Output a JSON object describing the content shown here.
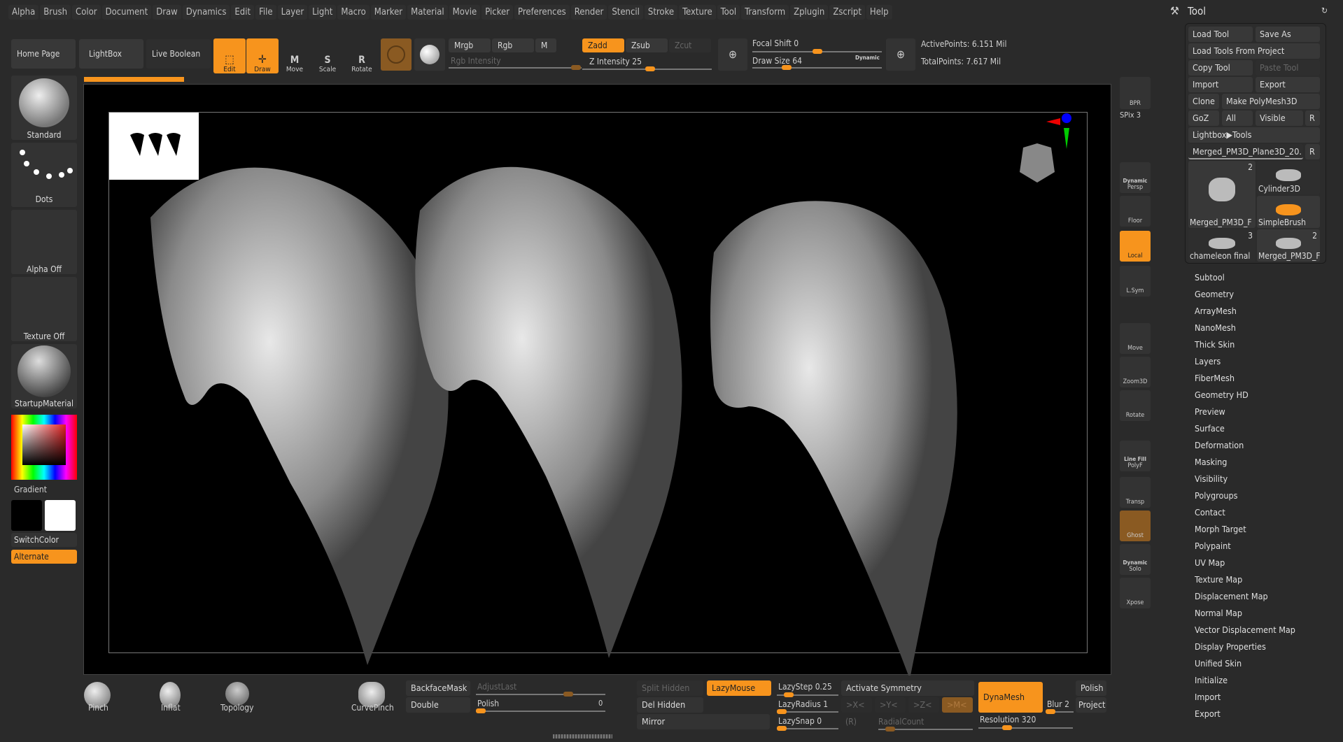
{
  "menu": [
    "Alpha",
    "Brush",
    "Color",
    "Document",
    "Draw",
    "Dynamics",
    "Edit",
    "File",
    "Layer",
    "Light",
    "Macro",
    "Marker",
    "Material",
    "Movie",
    "Picker",
    "Preferences",
    "Render",
    "Stencil",
    "Stroke",
    "Texture",
    "Tool",
    "Transform",
    "Zplugin",
    "Zscript",
    "Help"
  ],
  "toolbar": {
    "home": "Home Page",
    "lightbox": "LightBox",
    "live_boolean": "Live Boolean",
    "edit": "Edit",
    "draw": "Draw",
    "move": "Move",
    "scale": "Scale",
    "rotate": "Rotate",
    "mrgb": "Mrgb",
    "rgb": "Rgb",
    "m": "M",
    "rgb_intensity": "Rgb Intensity",
    "zadd": "Zadd",
    "zsub": "Zsub",
    "zcut": "Zcut",
    "z_intensity": "Z Intensity 25",
    "z_intensity_value": 25,
    "focal_shift": "Focal Shift 0",
    "draw_size": "Draw Size 64",
    "dynamic": "Dynamic",
    "active_points": "ActivePoints: 6.151 Mil",
    "total_points": "TotalPoints: 7.617 Mil"
  },
  "left": {
    "brush": "Standard",
    "stroke": "Dots",
    "alpha": "Alpha Off",
    "texture": "Texture Off",
    "material": "StartupMaterial",
    "gradient": "Gradient",
    "switch": "SwitchColor",
    "alternate": "Alternate",
    "primary_color": "#000000",
    "secondary_color": "#ffffff"
  },
  "shelf": {
    "bpr": "BPR",
    "spix": "SPix 3",
    "persp": "Persp",
    "persp_top": "Dynamic",
    "floor": "Floor",
    "local": "Local",
    "lsym": "L.Sym",
    "move": "Move",
    "zoom": "Zoom3D",
    "rotate": "Rotate",
    "polyf": "PolyF",
    "polyf_top": "Line Fill",
    "transp": "Transp",
    "ghost": "Ghost",
    "solo": "Solo",
    "solo_top": "Dynamic",
    "xpose": "Xpose"
  },
  "tool": {
    "title": "Tool",
    "load": "Load Tool",
    "save": "Save As",
    "load_project": "Load Tools From Project",
    "copy": "Copy Tool",
    "paste": "Paste Tool",
    "import": "Import",
    "export": "Export",
    "clone": "Clone",
    "make_poly": "Make PolyMesh3D",
    "goz": "GoZ",
    "all": "All",
    "visible": "Visible",
    "r": "R",
    "lightbox_tools": "Lightbox▶Tools",
    "current": "Merged_PM3D_Plane3D_20.",
    "thumbs": [
      {
        "label": "Merged_PM3D_F",
        "count": "2"
      },
      {
        "label": "Cylinder3D",
        "count": ""
      },
      {
        "label": "SimpleBrush",
        "count": ""
      },
      {
        "label": "chameleon final",
        "count": "3"
      },
      {
        "label": "Merged_PM3D_F",
        "count": "2"
      }
    ],
    "subpalettes": [
      "Subtool",
      "Geometry",
      "ArrayMesh",
      "NanoMesh",
      "Thick Skin",
      "Layers",
      "FiberMesh",
      "Geometry HD",
      "Preview",
      "Surface",
      "Deformation",
      "Masking",
      "Visibility",
      "Polygroups",
      "Contact",
      "Morph Target",
      "Polypaint",
      "UV Map",
      "Texture Map",
      "Displacement Map",
      "Normal Map",
      "Vector Displacement Map",
      "Display Properties",
      "Unified Skin",
      "Initialize",
      "Import",
      "Export"
    ]
  },
  "bottom": {
    "pinch": "Pinch",
    "inflat": "Inflat",
    "topology": "Topology",
    "curvepinch": "CurvePinch",
    "backface": "BackfaceMask",
    "adjustlast": "AdjustLast",
    "double": "Double",
    "polish_slider": "Polish",
    "polish_value": "0",
    "split_hidden": "Split Hidden",
    "lazymouse": "LazyMouse",
    "lazystep": "LazyStep 0.25",
    "activate_sym": "Activate Symmetry",
    "dynamesh": "DynaMesh",
    "polish": "Polish",
    "del_hidden": "Del Hidden",
    "lazyradius": "LazyRadius 1",
    "x": ">X<",
    "y": ">Y<",
    "z": ">Z<",
    "m": ">M<",
    "blur": "Blur 2",
    "project": "Project",
    "mirror": "Mirror",
    "lazysnap": "LazySnap 0",
    "r": "(R)",
    "radialcount": "RadialCount",
    "resolution": "Resolution 320"
  },
  "colors": {
    "accent": "#f7941d",
    "bg": "#2a2a2a"
  }
}
